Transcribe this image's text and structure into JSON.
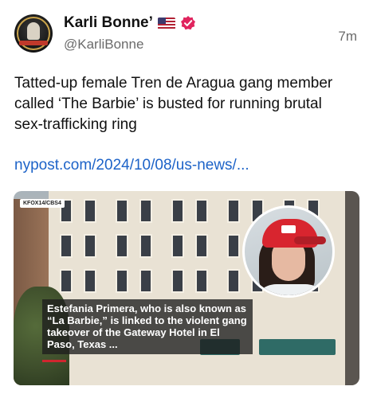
{
  "post": {
    "display_name": "Karli Bonne’",
    "handle": "@KarliBonne",
    "timestamp": "7m",
    "flag_icon": "us-flag-icon",
    "verified_icon": "verified-badge-icon",
    "verified_color": "#e0245e",
    "text": "Tatted-up female Tren de Aragua gang member called ‘The Barbie’ is busted for running brutal sex-trafficking ring",
    "link_text": "nypost.com/2024/10/08/us-news/...",
    "link_color": "#1d63c8"
  },
  "media": {
    "station_tag": "KFOX14/CBS4",
    "caption": "Estefania Primera, who is also known as “La Barbie,” is linked to the violent gang takeover of the Gateway Hotel in El Paso, Texas ..."
  }
}
